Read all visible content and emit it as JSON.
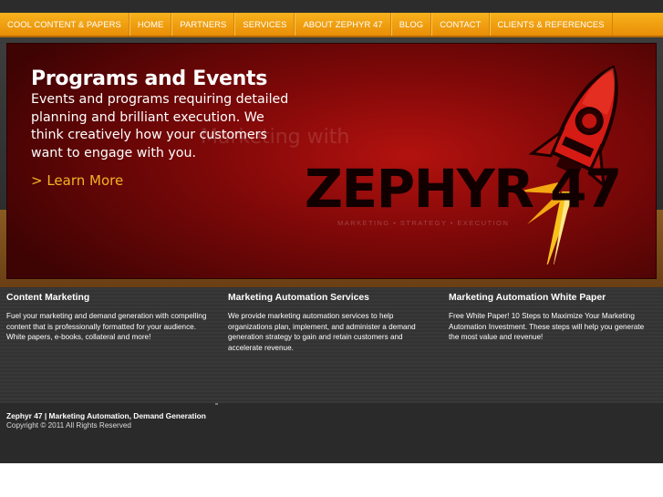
{
  "nav": {
    "items": [
      {
        "label": "COOL CONTENT & PAPERS"
      },
      {
        "label": "HOME"
      },
      {
        "label": "PARTNERS"
      },
      {
        "label": "SERVICES"
      },
      {
        "label": "ABOUT ZEPHYR 47"
      },
      {
        "label": "BLOG"
      },
      {
        "label": "CONTACT"
      },
      {
        "label": "CLIENTS & REFERENCES"
      }
    ]
  },
  "banner": {
    "title": "Programs and Events",
    "text": "Events and programs requiring detailed planning and brilliant execution. We think creatively how your customers want to engage with you.",
    "link": "> Learn More",
    "ghost_text": "Marketing with",
    "brand": "ZEPHYR 47",
    "tagline": "MARKETING • STRATEGY • EXECUTION"
  },
  "columns": [
    {
      "heading": "Content Marketing",
      "body": "Fuel your marketing and demand generation with compelling content that is professionally formatted for your audience. White papers, e-books, collateral and more!"
    },
    {
      "heading": "Marketing Automation Services",
      "body": "We provide marketing automation services to help organizations plan, implement, and administer a demand generation strategy to gain and retain customers and accelerate revenue."
    },
    {
      "heading": "Marketing Automation White Paper",
      "body": "Free White Paper! 10 Steps to Maximize Your Marketing Automation Investment. These steps will help you generate the most value and revenue!"
    }
  ],
  "footer": {
    "title": "Zephyr 47 | Marketing Automation, Demand Generation",
    "copyright": "Copyright © 2011 All Rights Reserved"
  },
  "colors": {
    "nav_orange": "#f0a010",
    "banner_red": "#9a0d0b",
    "link_gold": "#f5b324",
    "footer_bg": "#2a2a2a"
  }
}
